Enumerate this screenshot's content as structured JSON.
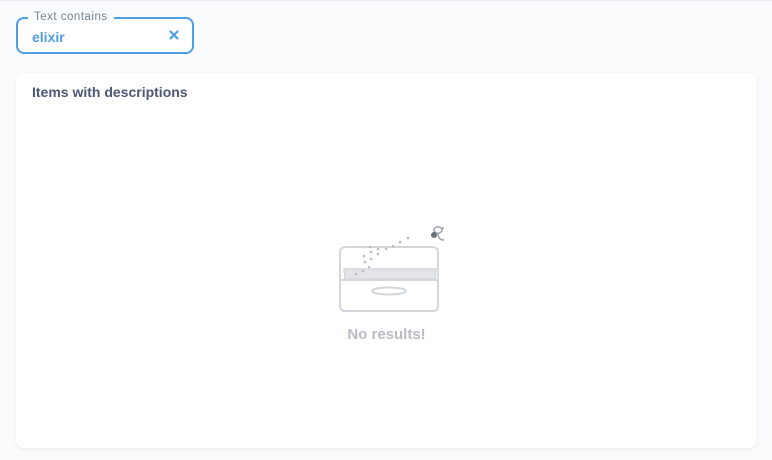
{
  "filter": {
    "label": "Text contains",
    "value": "elixir",
    "clear_icon": "close-icon",
    "accent_color": "#509ee3"
  },
  "card": {
    "title": "Items with descriptions",
    "empty_state": {
      "message": "No results!",
      "illustration": "empty-box-illustration"
    }
  }
}
